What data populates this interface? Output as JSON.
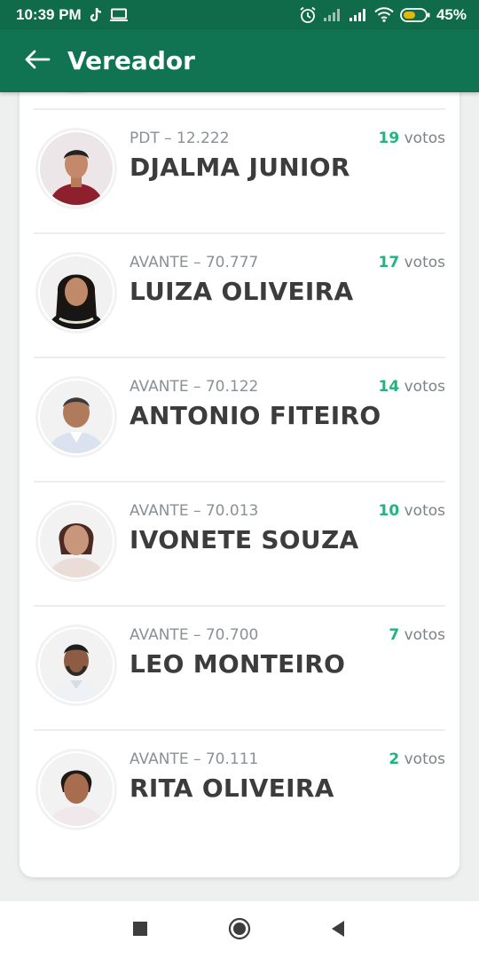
{
  "status_bar": {
    "time": "10:39 PM",
    "battery": "45%",
    "icons": [
      "tiktok-icon",
      "screen-icon",
      "alarm-icon",
      "signal-icon",
      "signal-icon",
      "wifi-icon",
      "battery-icon"
    ]
  },
  "app_bar": {
    "back_icon": "arrow-left-icon",
    "title": "Vereador"
  },
  "candidates": [
    {
      "party": "PDT – 12.222",
      "name": "DJALMA JUNIOR",
      "votes_num": "19",
      "votes_label": " votos"
    },
    {
      "party": "AVANTE – 70.777",
      "name": "LUIZA OLIVEIRA",
      "votes_num": "17",
      "votes_label": " votos"
    },
    {
      "party": "AVANTE – 70.122",
      "name": "ANTONIO FITEIRO",
      "votes_num": "14",
      "votes_label": " votos"
    },
    {
      "party": "AVANTE – 70.013",
      "name": "IVONETE SOUZA",
      "votes_num": "10",
      "votes_label": " votos"
    },
    {
      "party": "AVANTE – 70.700",
      "name": "LEO MONTEIRO",
      "votes_num": "7",
      "votes_label": " votos"
    },
    {
      "party": "AVANTE – 70.111",
      "name": "RITA OLIVEIRA",
      "votes_num": "2",
      "votes_label": " votos"
    }
  ],
  "colors": {
    "primary": "#107351",
    "status_bar": "#0f6b4a",
    "votes_accent": "#1fb57c"
  },
  "nav_bar": {
    "icons": [
      "recent-apps-icon",
      "home-icon",
      "back-icon"
    ]
  }
}
